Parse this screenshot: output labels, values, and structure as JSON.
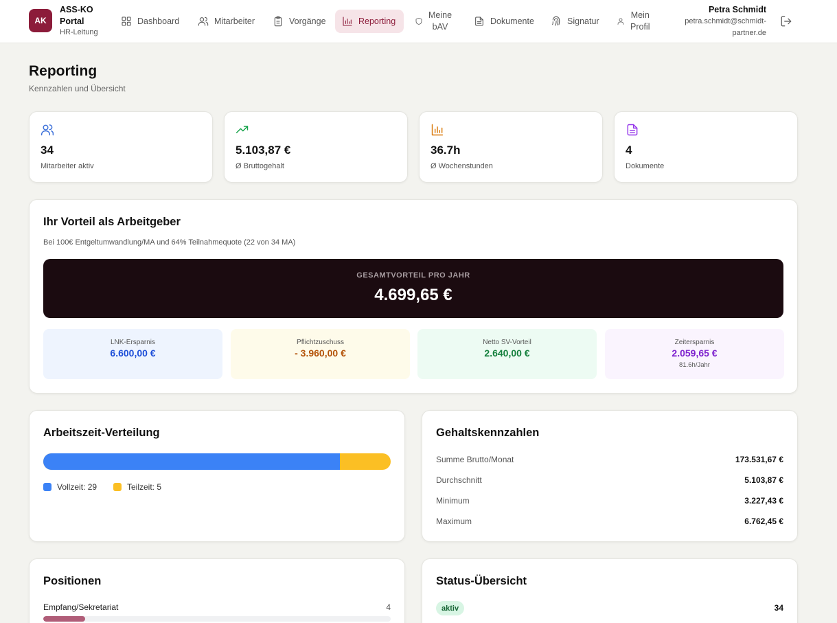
{
  "app": {
    "logo": "AK",
    "name_line1": "ASS-KO",
    "name_line2": "Portal",
    "role": "HR-Leitung"
  },
  "nav": [
    {
      "label": "Dashboard",
      "icon": "grid-icon"
    },
    {
      "label": "Mitarbeiter",
      "icon": "users-icon"
    },
    {
      "label": "Vorgänge",
      "icon": "clipboard-icon"
    },
    {
      "label": "Reporting",
      "icon": "bar-chart-icon",
      "active": true
    },
    {
      "label": "Meine\nbAV",
      "icon": "shield-icon"
    },
    {
      "label": "Dokumente",
      "icon": "document-icon"
    },
    {
      "label": "Signatur",
      "icon": "fingerprint-icon"
    },
    {
      "label": "Mein\nProfil",
      "icon": "user-icon"
    }
  ],
  "user": {
    "name": "Petra Schmidt",
    "email": "petra.schmidt@schmidt-partner.de"
  },
  "page": {
    "title": "Reporting",
    "subtitle": "Kennzahlen und Übersicht"
  },
  "kpis": [
    {
      "value": "34",
      "label": "Mitarbeiter aktiv",
      "icon": "users-icon",
      "color": "#3b6fd9"
    },
    {
      "value": "5.103,87 €",
      "label": "Ø Bruttogehalt",
      "icon": "trending-up-icon",
      "color": "#16a34a"
    },
    {
      "value": "36.7h",
      "label": "Ø Wochenstunden",
      "icon": "bar-chart-icon",
      "color": "#d97706"
    },
    {
      "value": "4",
      "label": "Dokumente",
      "icon": "document-icon",
      "color": "#9333ea"
    }
  ],
  "advantage": {
    "title": "Ihr Vorteil als Arbeitgeber",
    "subtitle": "Bei 100€ Entgeltumwandlung/MA und 64% Teilnahmequote (22 von 34 MA)",
    "total_label": "GESAMTVORTEIL PRO JAHR",
    "total_value": "4.699,65 €",
    "tiles": [
      {
        "label": "LNK-Ersparnis",
        "value": "6.600,00 €",
        "note": "",
        "bg": "#eef4fe",
        "color": "#1d4ed8"
      },
      {
        "label": "Pflichtzuschuss",
        "value": "- 3.960,00 €",
        "note": "",
        "bg": "#fefbea",
        "color": "#b45309"
      },
      {
        "label": "Netto SV-Vorteil",
        "value": "2.640,00 €",
        "note": "",
        "bg": "#edfbf3",
        "color": "#15803d"
      },
      {
        "label": "Zeitersparnis",
        "value": "2.059,65 €",
        "note": "81.6h/Jahr",
        "bg": "#faf4fe",
        "color": "#7e22ce"
      }
    ]
  },
  "worktime": {
    "title": "Arbeitszeit-Verteilung",
    "fulltime_label": "Vollzeit: 29",
    "parttime_label": "Teilzeit: 5",
    "fulltime": 29,
    "parttime": 5,
    "fulltime_color": "#3b82f6",
    "parttime_color": "#fbbf24"
  },
  "salary": {
    "title": "Gehaltskennzahlen",
    "rows": [
      {
        "label": "Summe Brutto/Monat",
        "value": "173.531,67 €"
      },
      {
        "label": "Durchschnitt",
        "value": "5.103,87 €"
      },
      {
        "label": "Minimum",
        "value": "3.227,43 €"
      },
      {
        "label": "Maximum",
        "value": "6.762,45 €"
      }
    ]
  },
  "positions": {
    "title": "Positionen",
    "items": [
      {
        "label": "Empfang/Sekretariat",
        "count": "4",
        "share": 0.12
      }
    ]
  },
  "status": {
    "title": "Status-Übersicht",
    "items": [
      {
        "label": "aktiv",
        "count": "34"
      }
    ]
  }
}
